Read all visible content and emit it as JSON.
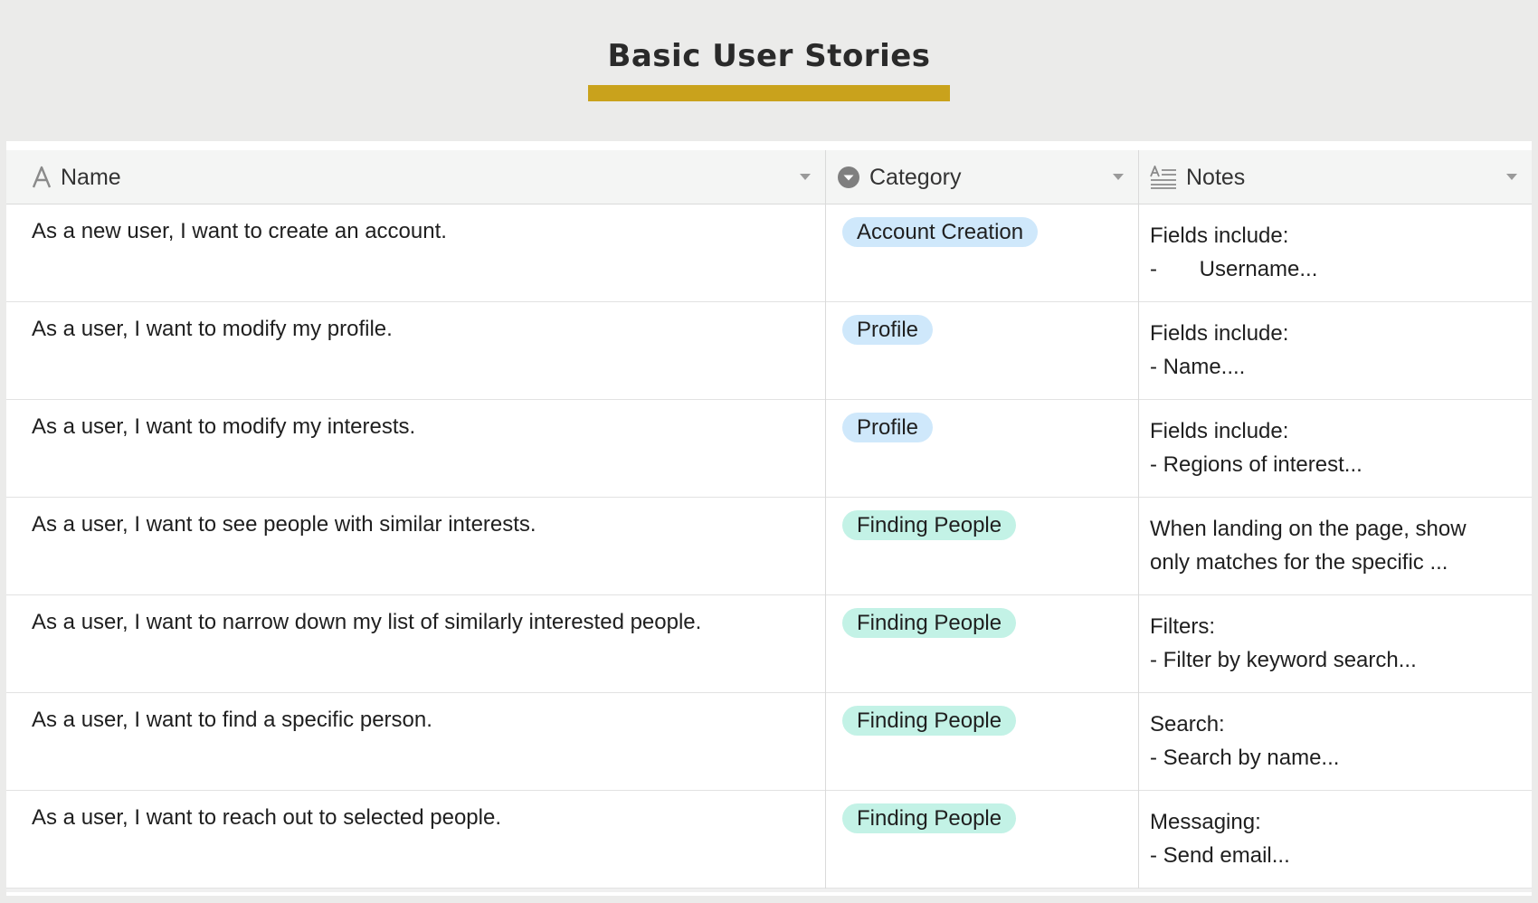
{
  "page": {
    "title": "Basic User Stories",
    "accent_color": "#c9a21c"
  },
  "table": {
    "columns": [
      {
        "label": "Name",
        "icon": "text-field-icon"
      },
      {
        "label": "Category",
        "icon": "single-select-icon"
      },
      {
        "label": "Notes",
        "icon": "long-text-icon"
      }
    ],
    "rows": [
      {
        "name": "As a new user, I want to create an account.",
        "category": "Account Creation",
        "category_color": "blue",
        "notes_line1": "Fields include:",
        "notes_line2": "-       Username..."
      },
      {
        "name": "As a user, I want to modify my profile.",
        "category": "Profile",
        "category_color": "blue",
        "notes_line1": "Fields include:",
        "notes_line2": "- Name...."
      },
      {
        "name": "As a user, I want to modify my interests.",
        "category": "Profile",
        "category_color": "blue",
        "notes_line1": "Fields include:",
        "notes_line2": "- Regions of interest..."
      },
      {
        "name": "As a user, I want to see people with similar interests.",
        "category": "Finding People",
        "category_color": "teal",
        "notes_line1": "When landing on the page, show",
        "notes_line2": "only matches for the specific ..."
      },
      {
        "name": "As a user, I want to narrow down my list of similarly interested people.",
        "category": "Finding People",
        "category_color": "teal",
        "notes_line1": "Filters:",
        "notes_line2": "- Filter by keyword search..."
      },
      {
        "name": "As a user, I want to find a specific person.",
        "category": "Finding People",
        "category_color": "teal",
        "notes_line1": "Search:",
        "notes_line2": "- Search by name..."
      },
      {
        "name": "As a user, I want to reach out to selected people.",
        "category": "Finding People",
        "category_color": "teal",
        "notes_line1": "Messaging:",
        "notes_line2": "- Send email..."
      }
    ]
  }
}
